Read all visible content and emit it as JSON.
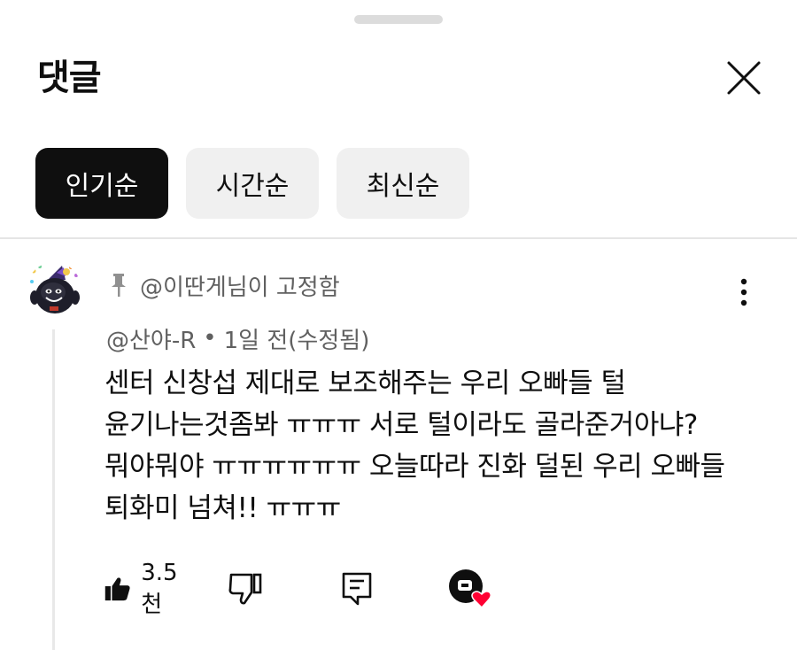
{
  "header": {
    "title": "댓글"
  },
  "sort_chips": [
    {
      "label": "인기순",
      "active": true
    },
    {
      "label": "시간순",
      "active": false
    },
    {
      "label": "최신순",
      "active": false
    }
  ],
  "comment": {
    "pinned_label": "@이딴게님이 고정함",
    "author": "@산야-R",
    "separator": "•",
    "time": "1일 전(수정됨)",
    "lines": [
      "센터 신창섭 제대로 보조해주는 우리 오빠들 털",
      "윤기나는것좀봐 ㅠㅠㅠ 서로 털이라도 골라준거아냐?",
      "뭐야뭐야 ㅠㅠㅠㅠㅠㅠ 오늘따라 진화 덜된 우리 오빠들",
      "퇴화미 넘쳐!! ㅠㅠㅠ"
    ],
    "like_count": "3.5천"
  },
  "icons": {
    "close": "close-icon",
    "pin": "pin-icon",
    "more": "more-vert-icon",
    "like": "thumbs-up-icon",
    "dislike": "thumbs-down-icon",
    "reply": "reply-icon",
    "creator_heart": "creator-heart-icon"
  },
  "colors": {
    "active_chip": "#0f0f0f",
    "inactive_chip": "#f0f0f0",
    "secondary_text": "#606060",
    "heart": "#ff0033"
  }
}
